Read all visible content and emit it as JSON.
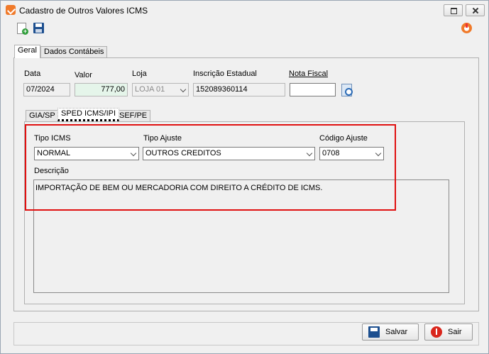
{
  "window": {
    "title": "Cadastro de Outros Valores ICMS"
  },
  "tabs": {
    "geral": "Geral",
    "dados_contabeis": "Dados Contábeis"
  },
  "fields": {
    "data": {
      "label": "Data",
      "value": "07/2024"
    },
    "valor": {
      "label": "Valor",
      "value": "777,00"
    },
    "loja": {
      "label": "Loja",
      "value": "LOJA 01"
    },
    "inscricao": {
      "label": "Inscrição Estadual",
      "value": "152089360114"
    },
    "nota_fiscal": {
      "label": "Nota Fiscal",
      "value": ""
    }
  },
  "subtabs": {
    "gia": "GIA/SP",
    "sped": "SPED ICMS/IPI",
    "sef": "SEF/PE"
  },
  "sped": {
    "tipo_icms": {
      "label": "Tipo ICMS",
      "value": "NORMAL"
    },
    "tipo_ajuste": {
      "label": "Tipo Ajuste",
      "value": "OUTROS CREDITOS"
    },
    "codigo_ajuste": {
      "label": "Código Ajuste",
      "value": "0708"
    },
    "descricao": {
      "label": "Descrição",
      "value": "IMPORTAÇÃO DE BEM OU MERCADORIA COM DIREITO A CRÉDITO DE ICMS."
    }
  },
  "buttons": {
    "salvar": "Salvar",
    "sair": "Sair"
  },
  "icons": {
    "app": "check-icon",
    "new": "new-document-icon",
    "save": "save-disk-icon",
    "power": "power-icon",
    "search": "search-document-icon"
  },
  "colors": {
    "highlight": "#e01010",
    "valor_bg": "#e5f5ea",
    "app_icon": "#f07a2a"
  }
}
